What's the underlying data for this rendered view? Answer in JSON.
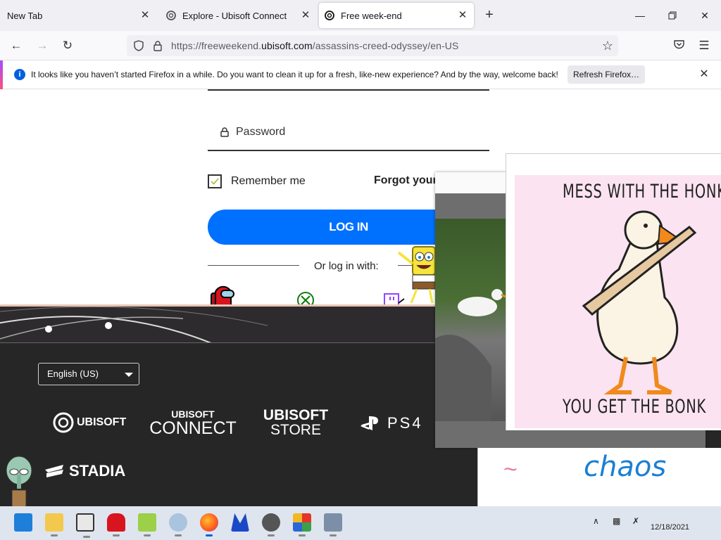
{
  "browser": {
    "tabs": [
      {
        "label": "New Tab",
        "active": false
      },
      {
        "label": "Explore - Ubisoft Connect",
        "active": false
      },
      {
        "label": "Free week-end",
        "active": true
      }
    ],
    "url_prefix": "https://freeweekend.",
    "url_domain": "ubisoft.com",
    "url_path": "/assassins-creed-odyssey/en-US",
    "notification": {
      "message": "It looks like you haven’t started Firefox in a while. Do you want to clean it up for a fresh, like-new experience? And by the way, welcome back!",
      "button": "Refresh Firefox…"
    }
  },
  "login": {
    "password_placeholder": "Password",
    "remember_label": "Remember me",
    "remember_checked": true,
    "forgot_label": "Forgot your",
    "login_button": "LOG IN",
    "or_text": "Or log in with:"
  },
  "footer": {
    "language": "English (US)",
    "logos": {
      "ubisoft": "UBISOFT",
      "connect_top": "UBISOFT",
      "connect_bottom": "CONNECT",
      "store_top": "UBISOFT",
      "store_bottom": "STORE",
      "ps4": "PS4",
      "stadia": "STADIA"
    }
  },
  "meme": {
    "top": "MESS WITH THE HONK",
    "bottom": "YOU GET THE BONK"
  },
  "overlay_text": {
    "chaos": "chaos",
    "tilde": "~"
  },
  "taskbar": {
    "date": "12/18/2021"
  },
  "colors": {
    "login_button": "#0070ff",
    "footer_bg": "#262626",
    "meme_bg": "#fbe3f1",
    "chaos_ink": "#1a7fd4"
  }
}
